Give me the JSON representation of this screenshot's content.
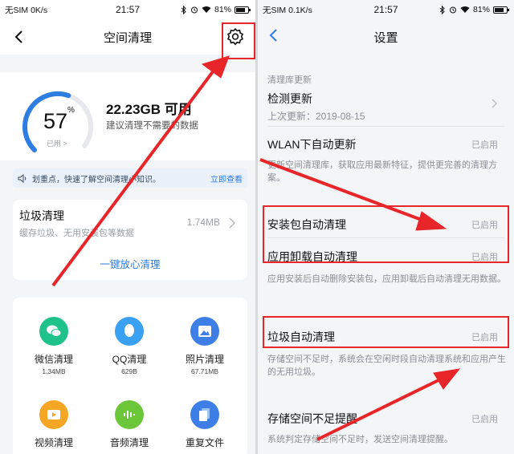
{
  "left": {
    "status": {
      "carrier": "无SIM 0K/s",
      "time": "21:57",
      "battery": "81%",
      "battery_level": 0.81
    },
    "nav": {
      "title": "空间清理"
    },
    "storage": {
      "percent": "57",
      "percent_sign": "%",
      "used_label": "已用 >",
      "used_fraction": 0.57,
      "free": "22.23GB 可用",
      "advice": "建议清理不需要的数据"
    },
    "tip": {
      "text": "划重点，快速了解空间清理小知识。",
      "link": "立即查看"
    },
    "junk": {
      "title": "垃圾清理",
      "subtitle": "缓存垃圾、无用安装包等数据",
      "size": "1.74MB",
      "button": "一键放心清理"
    },
    "grid": [
      {
        "label": "微信清理",
        "size": "1.34MB",
        "icon": "wechat-icon",
        "color": "#1fc28b"
      },
      {
        "label": "QQ清理",
        "size": "629B",
        "icon": "qq-icon",
        "color": "#3aa0f2"
      },
      {
        "label": "照片清理",
        "size": "67.71MB",
        "icon": "photo-icon",
        "color": "#3d7fe6"
      },
      {
        "label": "视频清理",
        "size": "",
        "icon": "video-icon",
        "color": "#f5a623"
      },
      {
        "label": "音频清理",
        "size": "",
        "icon": "audio-icon",
        "color": "#6cc63a"
      },
      {
        "label": "重复文件",
        "size": "",
        "icon": "duplicate-file-icon",
        "color": "#3d7fe6"
      }
    ]
  },
  "right": {
    "status": {
      "carrier": "无SIM 0.1K/s",
      "time": "21:57",
      "battery": "81%",
      "battery_level": 0.81
    },
    "nav": {
      "title": "设置"
    },
    "section1": "清理库更新",
    "check_update": {
      "label": "检测更新",
      "sub": "上次更新：2019-08-15"
    },
    "wlan": {
      "label": "WLAN下自动更新",
      "value": "已启用"
    },
    "wlan_desc": "更新空间清理库，获取应用最新特征，提供更完善的清理方案。",
    "apk": {
      "label": "安装包自动清理",
      "value": "已启用"
    },
    "uninstall": {
      "label": "应用卸载自动清理",
      "value": "已启用"
    },
    "apk_desc": "应用安装后自动删除安装包，应用卸载后自动清理无用数据。",
    "auto_junk": {
      "label": "垃圾自动清理",
      "value": "已启用"
    },
    "auto_junk_desc": "存储空间不足时，系统会在空闲时段自动清理系统和应用产生的无用垃圾。",
    "low_storage": {
      "label": "存储空间不足提醒",
      "value": "已启用"
    },
    "low_storage_desc": "系统判定存储空间不足时，发送空间清理提醒。"
  },
  "colors": {
    "accent": "#2d7de3",
    "annotation": "#e8262a"
  }
}
